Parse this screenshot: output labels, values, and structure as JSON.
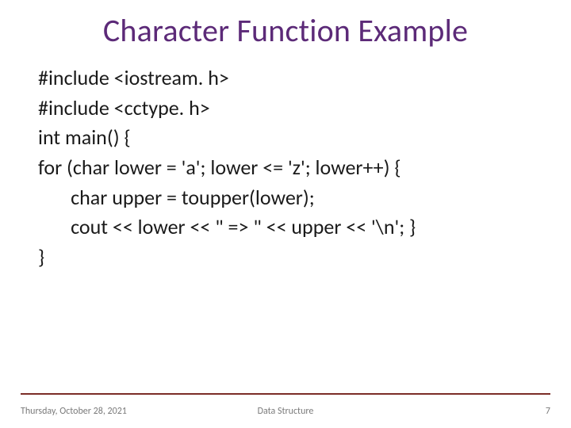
{
  "title": "Character Function Example",
  "code": {
    "l1": "#include <iostream. h>",
    "l2": "#include <cctype. h>",
    "l3": "int main() {",
    "l4": "for (char lower = 'a'; lower <= 'z'; lower++) {",
    "l5": "       char upper = toupper(lower);",
    "l6": "       cout << lower << \" => \" << upper << '\\n'; }",
    "l7": "}"
  },
  "footer": {
    "date": "Thursday, October 28, 2021",
    "center": "Data Structure",
    "page": "7"
  }
}
